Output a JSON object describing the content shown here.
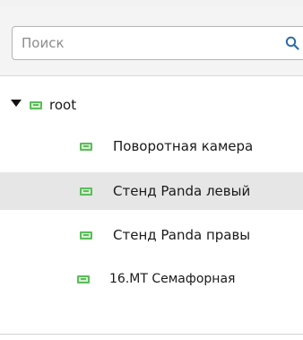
{
  "search": {
    "placeholder": "Поиск",
    "value": "",
    "icon": "search-icon"
  },
  "tree": {
    "root": {
      "label": "root",
      "expanded": true,
      "toggle_icon": "caret-down-icon",
      "icon": "device-icon"
    },
    "children": [
      {
        "label": "Поворотная камера",
        "icon": "device-icon",
        "selected": false
      },
      {
        "label": "Стенд Panda левый",
        "icon": "device-icon",
        "selected": true
      },
      {
        "label": "Стенд Panda правы",
        "icon": "device-icon",
        "selected": false
      },
      {
        "label": "16.МТ Семафорная",
        "icon": "device-icon",
        "selected": false
      }
    ]
  },
  "colors": {
    "device_icon": "#5bbd5b",
    "selected_row": "#e6e6e6",
    "search_panel": "#f4f4f4",
    "search_icon": "#2f6aa8"
  }
}
